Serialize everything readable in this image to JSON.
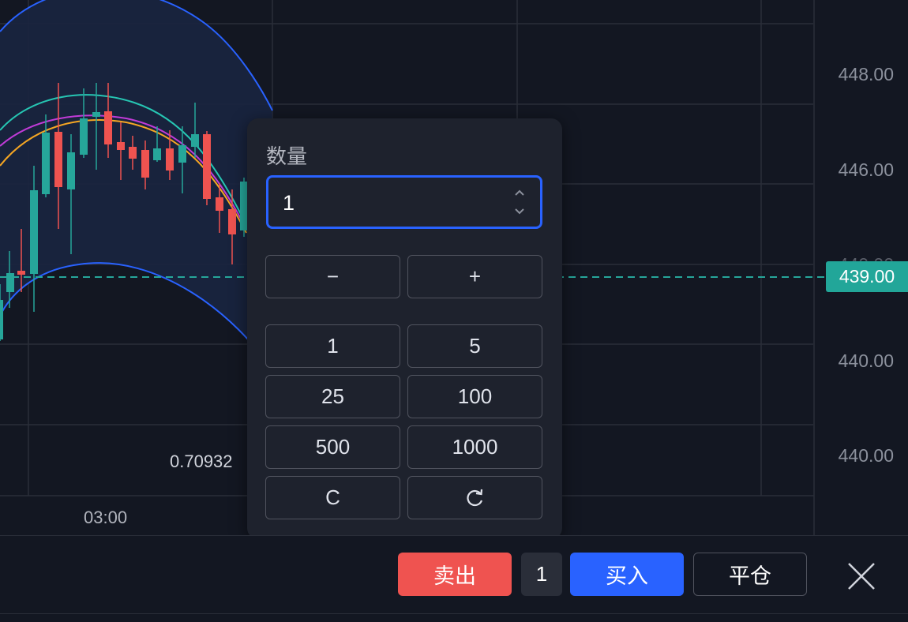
{
  "chart": {
    "price_axis": [
      "448.00",
      "446.00",
      "440.00",
      "440.00"
    ],
    "price_axis_hidden": "440.00",
    "current_price": "439.00",
    "time_label": "03:00",
    "indicator_value": "0.70932",
    "colors": {
      "background": "#131722",
      "up": "#26a69a",
      "down": "#ef5350",
      "bb_band": "#2962ff",
      "ma_teal": "#26c6b3",
      "ma_magenta": "#c13bd8",
      "ma_orange": "#f5a623"
    }
  },
  "popup": {
    "title": "数量",
    "input_value": "1",
    "spin_up_icon": "chevron-up-icon",
    "spin_down_icon": "chevron-down-icon",
    "minus_label": "−",
    "plus_label": "+",
    "presets": [
      "1",
      "5",
      "25",
      "100",
      "500",
      "1000"
    ],
    "clear_label": "C",
    "reset_icon": "refresh-icon"
  },
  "toolbar": {
    "sell_label": "卖出",
    "quantity": "1",
    "buy_label": "买入",
    "close_position_label": "平仓",
    "close_icon": "close-icon",
    "sell_color": "#ef5350",
    "buy_color": "#2962ff"
  }
}
